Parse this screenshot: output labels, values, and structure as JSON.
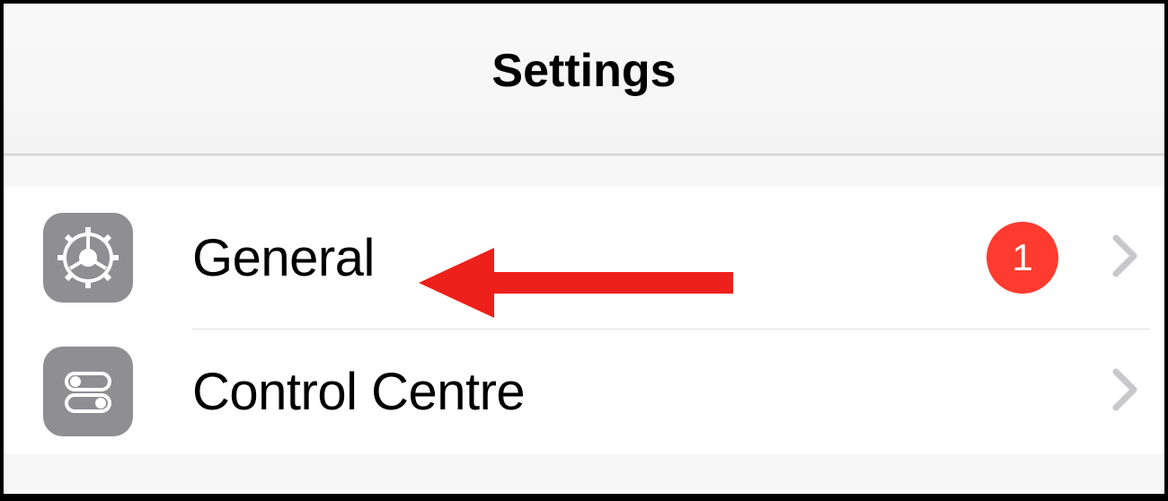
{
  "header": {
    "title": "Settings"
  },
  "list": {
    "items": [
      {
        "label": "General",
        "icon": "gear-icon",
        "badge": "1"
      },
      {
        "label": "Control Centre",
        "icon": "control-centre-icon"
      }
    ]
  }
}
